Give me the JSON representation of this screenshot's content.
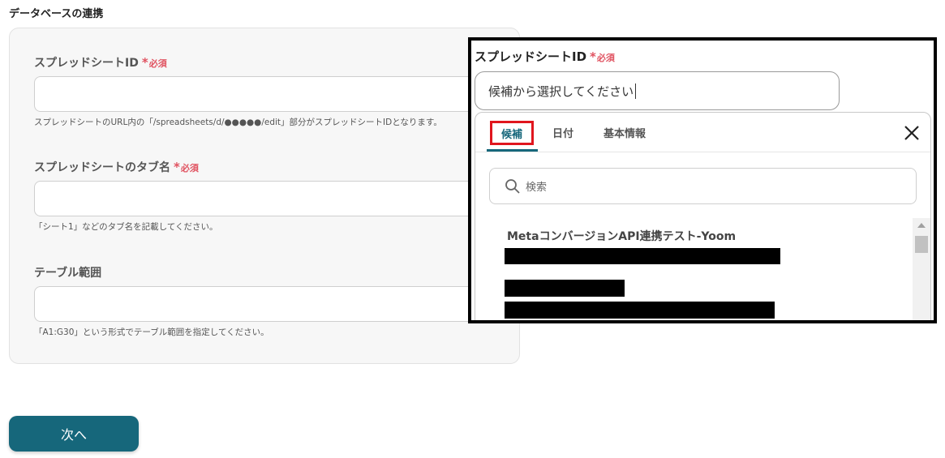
{
  "section_title": "データベースの連携",
  "required_text": "必須",
  "required_mark": "*",
  "fields": [
    {
      "label": "スプレッドシートID",
      "required": true,
      "value": "",
      "help": "スプレッドシートのURL内の「/spreadsheets/d/●●●●●/edit」部分がスプレッドシートIDとなります。"
    },
    {
      "label": "スプレッドシートのタブ名",
      "required": true,
      "value": "",
      "help": "「シート1」などのタブ名を記載してください。"
    },
    {
      "label": "テーブル範囲",
      "required": false,
      "value": "",
      "help": "「A1:G30」という形式でテーブル範囲を指定してください。"
    }
  ],
  "next_button": "次へ",
  "overlay": {
    "label": "スプレッドシートID",
    "input_placeholder": "候補から選択してください",
    "tabs": [
      "候補",
      "日付",
      "基本情報"
    ],
    "active_tab": "候補",
    "search_placeholder": "検索",
    "items": [
      {
        "title": "MetaコンバージョンAPI連携テスト-Yoom"
      }
    ]
  },
  "colors": {
    "accent": "#16677b",
    "required": "#e05260",
    "highlight_box": "#e0161e"
  },
  "icons": [
    "close-icon",
    "search-icon",
    "scroll-up-arrow-icon"
  ]
}
